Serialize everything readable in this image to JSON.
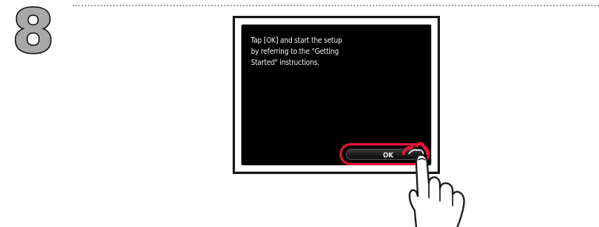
{
  "step": {
    "number": "8"
  },
  "device_screen": {
    "message": "Tap [OK] and start the setup\nby referring to the \"Getting\nStarted\" instructions.",
    "ok_label": "OK"
  },
  "colors": {
    "highlight": "#e0153a",
    "screen_background": "#000000",
    "step_number_fill": "#a8a8a8",
    "divider": "#a8a8a8"
  },
  "icons": {
    "tap_indicator": "tap-ripple-icon",
    "finger": "pointing-hand-icon"
  }
}
